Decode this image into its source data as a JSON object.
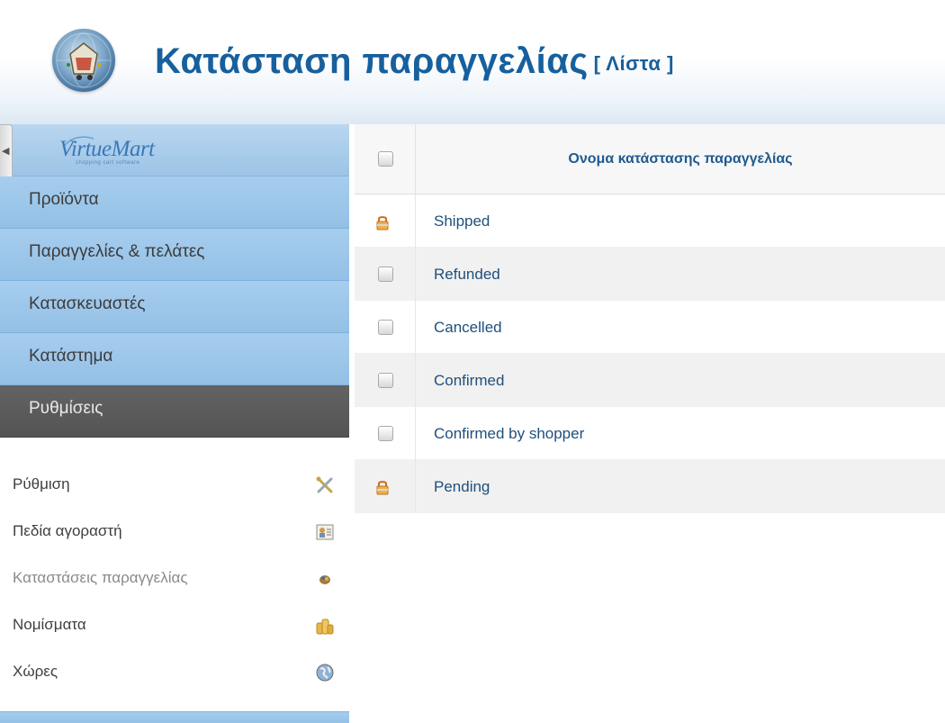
{
  "header": {
    "title": "Κατάσταση παραγγελίας",
    "subtitle": "[ Λίστα ]",
    "logo_icon": "virtuemart-globe-icon"
  },
  "sidebar": {
    "brand": "VirtueMart",
    "brand_tagline": "shopping cart software",
    "nav": [
      {
        "label": "Προϊόντα",
        "active": false
      },
      {
        "label": "Παραγγελίες & πελάτες",
        "active": false
      },
      {
        "label": "Κατασκευαστές",
        "active": false
      },
      {
        "label": "Κατάστημα",
        "active": false
      },
      {
        "label": "Ρυθμίσεις",
        "active": true
      }
    ],
    "sub_items": [
      {
        "label": "Ρύθμιση",
        "icon": "tools-icon"
      },
      {
        "label": "Πεδία αγοραστή",
        "icon": "user-fields-icon"
      },
      {
        "label": "Καταστάσεις παραγγελίας",
        "icon": "order-status-icon",
        "current": true
      },
      {
        "label": "Νομίσματα",
        "icon": "coins-icon"
      },
      {
        "label": "Χώρες",
        "icon": "globe-icon"
      }
    ]
  },
  "table": {
    "header": "Ονομα κατάστασης παραγγελίας",
    "rows": [
      {
        "name": "Shipped",
        "locked": true
      },
      {
        "name": "Refunded",
        "locked": false
      },
      {
        "name": "Cancelled",
        "locked": false
      },
      {
        "name": "Confirmed",
        "locked": false
      },
      {
        "name": "Confirmed by shopper",
        "locked": false
      },
      {
        "name": "Pending",
        "locked": true
      }
    ]
  },
  "colors": {
    "title": "#17609d",
    "nav_bg": "#9cc6ea",
    "nav_active_bg": "#5a5a5a",
    "row_link": "#1f4f7c"
  }
}
